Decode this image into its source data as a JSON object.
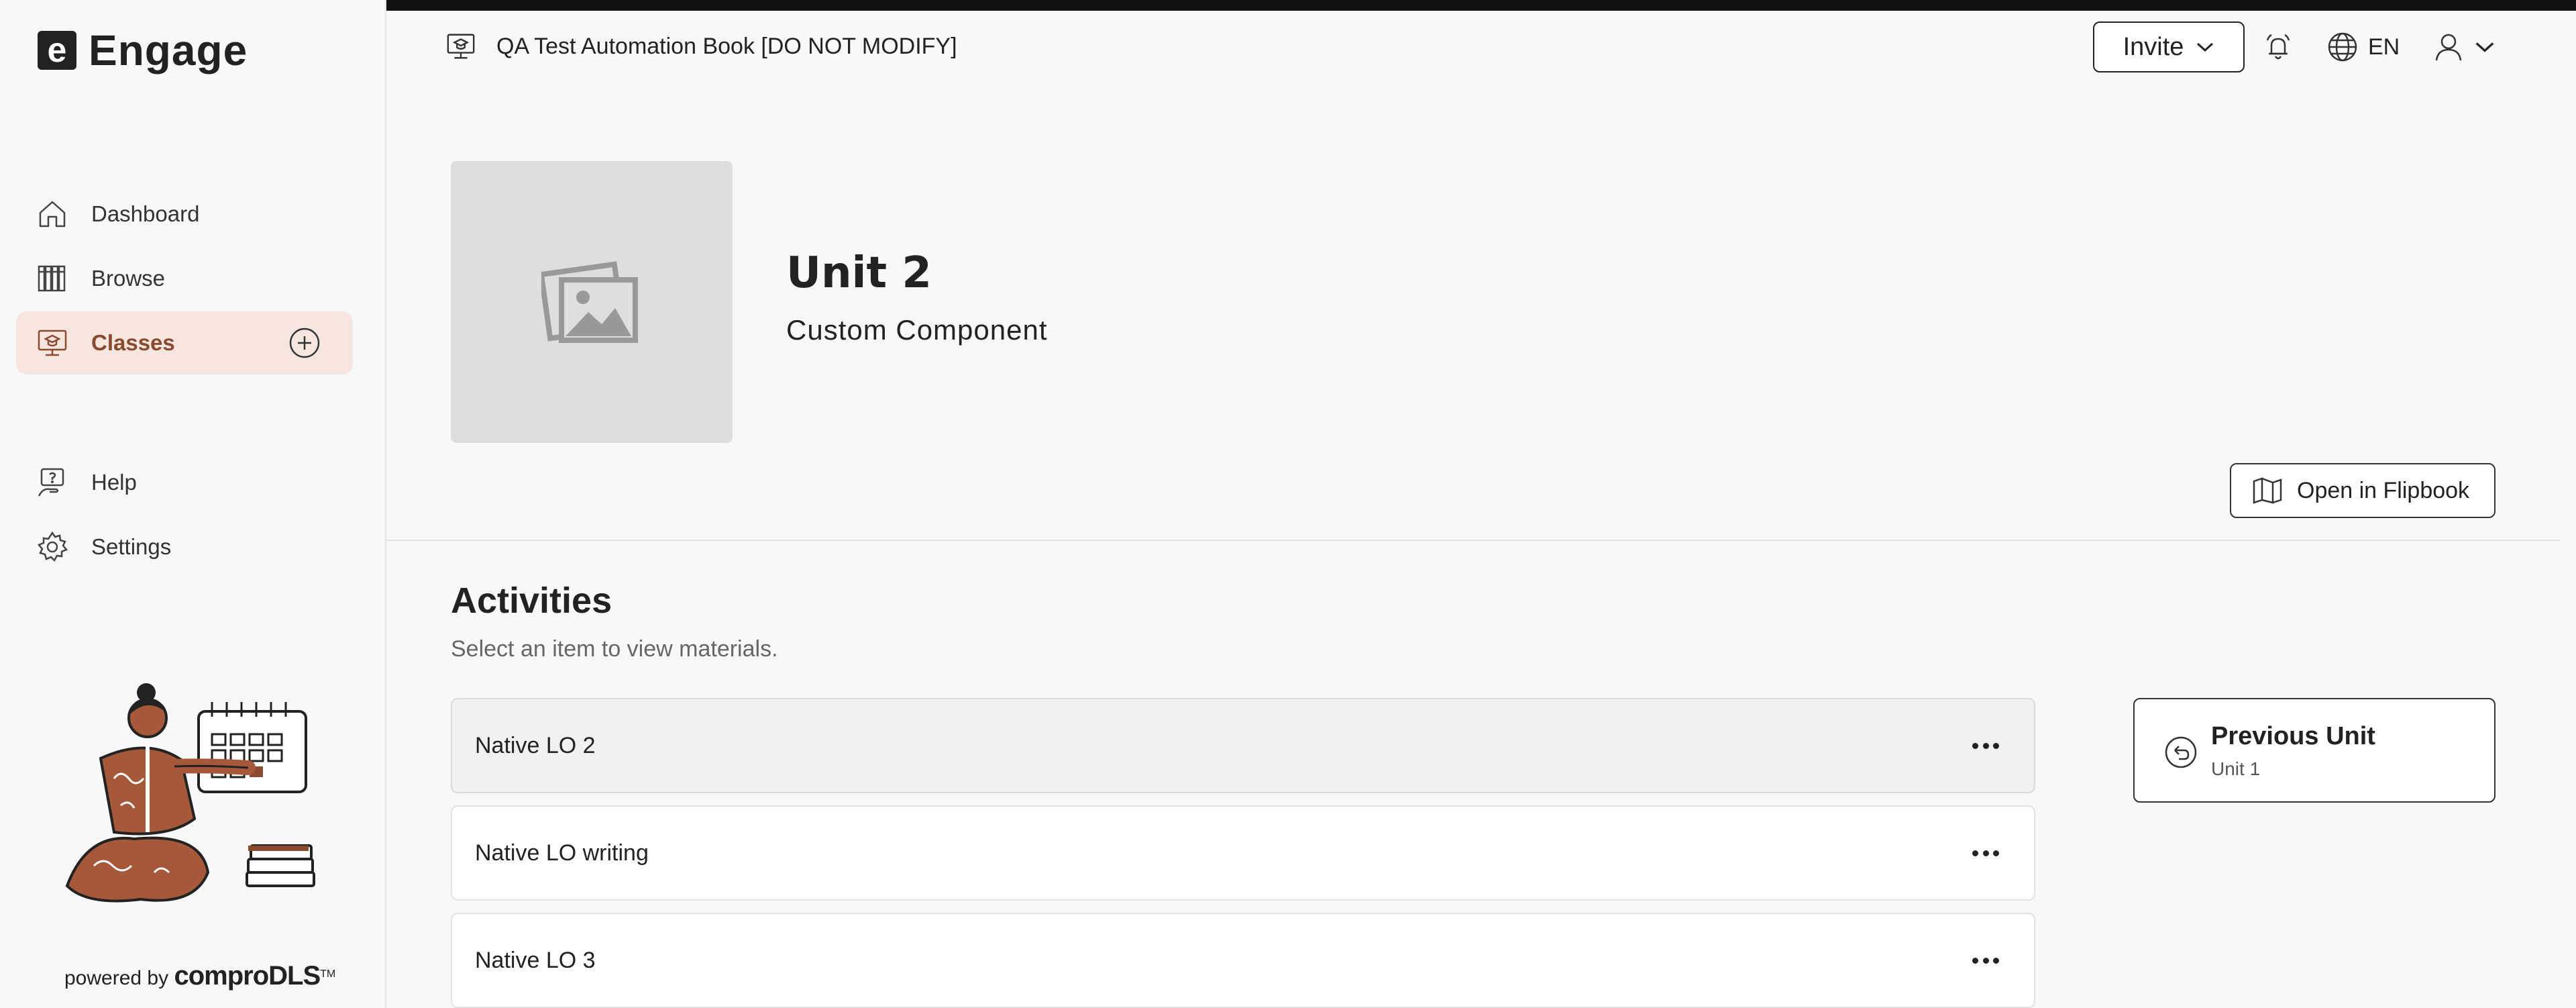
{
  "app": {
    "name": "Engage",
    "logo_letter": "e"
  },
  "sidebar": {
    "items": [
      {
        "label": "Dashboard",
        "icon": "home-icon"
      },
      {
        "label": "Browse",
        "icon": "books-icon"
      },
      {
        "label": "Classes",
        "icon": "classroom-icon",
        "active": true
      },
      {
        "label": "Help",
        "icon": "help-icon"
      },
      {
        "label": "Settings",
        "icon": "gear-icon"
      }
    ],
    "powered_by": "powered by",
    "brand": "comproDLS",
    "trademark": "TM"
  },
  "header": {
    "book_title": "QA Test Automation Book [DO NOT MODIFY]",
    "invite_label": "Invite",
    "language": "EN"
  },
  "unit": {
    "title": "Unit 2",
    "subtitle": "Custom Component",
    "flipbook_label": "Open in Flipbook"
  },
  "activities": {
    "title": "Activities",
    "subtitle": "Select an item to view materials.",
    "items": [
      {
        "label": "Native LO 2",
        "selected": true
      },
      {
        "label": "Native LO writing"
      },
      {
        "label": "Native LO 3"
      }
    ]
  },
  "navigation": {
    "previous_label": "Previous Unit",
    "previous_unit": "Unit 1"
  },
  "colors": {
    "accent": "#8a4a2f",
    "active_bg": "#f7e6e0",
    "top_bar": "#111111"
  }
}
